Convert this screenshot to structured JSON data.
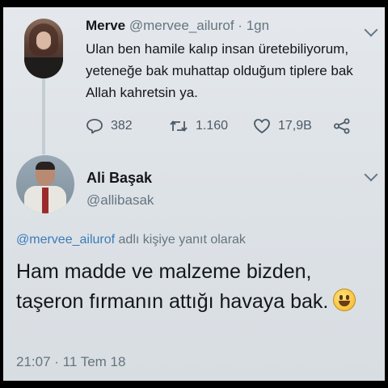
{
  "parent_tweet": {
    "display_name": "Merve",
    "handle": "@mervee_ailurof",
    "separator": " · ",
    "age": "1gn",
    "text": "Ulan ben hamile kalıp insan üretebiliyorum, yeteneğe bak muhattap olduğum tiplere bak Allah kahretsin ya.",
    "replies": "382",
    "retweets": "1.160",
    "likes": "17,9B"
  },
  "reply_tweet": {
    "display_name": "Ali Başak",
    "handle": "@allibasak",
    "reply_mention": "@mervee_ailurof",
    "reply_suffix": " adlı kişiye yanıt olarak",
    "text": "Ham madde ve malzeme bizden, taşeron fırmanın attığı havaya bak.",
    "timestamp": "21:07 · 11 Tem 18"
  },
  "icons": {
    "reply": "reply-icon",
    "retweet": "retweet-icon",
    "like": "like-icon",
    "share": "share-icon",
    "menu": "chevron-down-icon",
    "emoji": "grinning-face-emoji"
  },
  "colors": {
    "background": "#dfe4e9",
    "text": "#14171a",
    "muted": "#66757f",
    "mention": "#3b7bb8"
  }
}
